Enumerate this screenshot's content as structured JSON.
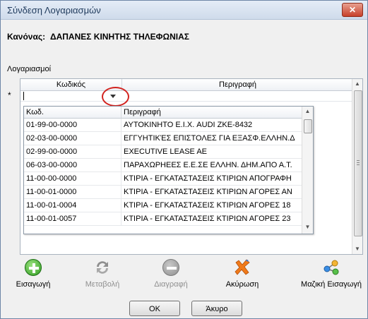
{
  "window": {
    "title": "Σύνδεση Λογαριασμών",
    "close_glyph": "✕"
  },
  "rule": {
    "label": "Κανόνας:",
    "value": "ΔΑΠΑΝΕΣ ΚΙΝΗΤΗΣ ΤΗΛΕΦΩΝΙΑΣ"
  },
  "accounts": {
    "section_label": "Λογαριασμοί",
    "columns": {
      "code": "Κωδικός",
      "description": "Περιγραφή"
    },
    "new_row_marker": "*"
  },
  "dropdown": {
    "columns": {
      "code": "Κωδ.",
      "description": "Περιγραφή"
    },
    "rows": [
      {
        "code": "01-99-00-0000",
        "description": "ΑΥΤΟΚΙΝΗΤΟ Ε.Ι.Χ. AUDI ZKE-8432"
      },
      {
        "code": "02-03-00-0000",
        "description": "ΕΓΓΥΗΤΙΚΈΣ ΕΠΙΣΤΟΛΕΣ ΓΙΑ ΕΞΑΣΦ.ΕΛΛΗΝ.Δ"
      },
      {
        "code": "02-99-00-0000",
        "description": "EXECUTIVE LEASE AE"
      },
      {
        "code": "06-03-00-0000",
        "description": "ΠΑΡΑΧΩΡΗΕΕΣ Ε.Ε.ΣΕ ΕΛΛΗΝ. ΔΗΜ.ΑΠΟ Α.Τ."
      },
      {
        "code": "11-00-00-0000",
        "description": "ΚΤΙΡΙΑ - ΕΓΚΑΤΑΣΤΑΣΕΙΣ ΚΤΙΡΙΩΝ ΑΠΟΓΡΑΦΗ"
      },
      {
        "code": "11-00-01-0000",
        "description": "ΚΤΙΡΙΑ - ΕΓΚΑΤΑΣΤΑΣΕΙΣ ΚΤΙΡΙΩΝ ΑΓΟΡΕΣ ΑΝ"
      },
      {
        "code": "11-00-01-0004",
        "description": "ΚΤΙΡΙΑ - ΕΓΚΑΤΑΣΤΑΣΕΙΣ ΚΤΙΡΙΩΝ ΑΓΟΡΕΣ 18"
      },
      {
        "code": "11-00-01-0057",
        "description": "ΚΤΙΡΙΑ - ΕΓΚΑΤΑΣΤΑΣΕΙΣ ΚΤΙΡΙΩΝ ΑΓΟΡΕΣ 23"
      }
    ]
  },
  "toolbar": {
    "add": {
      "label": "Εισαγωγή",
      "icon": "add-icon"
    },
    "edit": {
      "label": "Μεταβολή",
      "icon": "refresh-icon"
    },
    "delete": {
      "label": "Διαγραφή",
      "icon": "remove-icon"
    },
    "cancel": {
      "label": "Ακύρωση",
      "icon": "x-icon"
    },
    "bulk": {
      "label": "Μαζική Εισαγωγή",
      "icon": "network-icon"
    }
  },
  "footer": {
    "ok": "OK",
    "cancel": "Άκυρο"
  },
  "colors": {
    "highlight_ring": "#d2231f",
    "add_green": "#2e9b1f",
    "cancel_orange": "#f07a1a",
    "title_text": "#1e395b"
  }
}
